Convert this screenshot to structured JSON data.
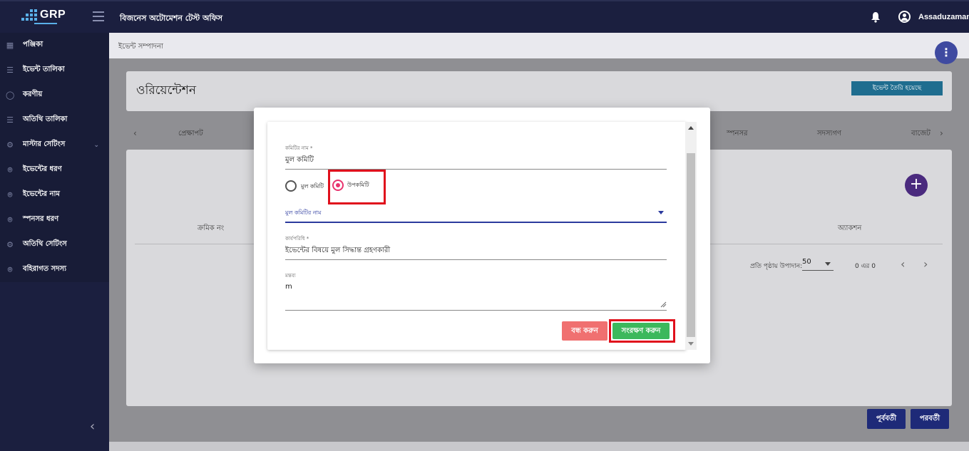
{
  "header": {
    "logo_text": "GRP",
    "app_title": "বিজনেস অটোমেশন টেস্ট অফিস",
    "user_name": "Assaduzaman"
  },
  "sidebar": {
    "items": [
      {
        "label": "পঞ্জিকা",
        "icon": "calendar-icon"
      },
      {
        "label": "ইভেন্ট তালিকা",
        "icon": "list-icon"
      },
      {
        "label": "করণীয়",
        "icon": "check-circle-icon"
      },
      {
        "label": "অতিথি তালিকা",
        "icon": "list-icon"
      },
      {
        "label": "মাস্টার সেটিংস",
        "icon": "gear-icon"
      },
      {
        "label": "ইভেন্টের ধরণ",
        "icon": "location-icon"
      },
      {
        "label": "ইভেন্টের নাম",
        "icon": "location-icon"
      },
      {
        "label": "স্পনসর ধরণ",
        "icon": "location-icon"
      },
      {
        "label": "অতিথি সেটিংস",
        "icon": "gear-icon"
      },
      {
        "label": "বহিরাগত সদস্য",
        "icon": "location-icon"
      }
    ]
  },
  "breadcrumb": "ইভেন্ট সম্পাদনা",
  "page": {
    "title": "ওরিয়েন্টেশন",
    "status_button": "ইভেন্ট তৈরি হয়েছে"
  },
  "tabs": {
    "items": [
      "প্রেক্ষাপট",
      "স্পনসর",
      "সদস্যগণ",
      "বাজেট"
    ]
  },
  "table": {
    "col_serial": "ক্রমিক নং",
    "col_action": "অ্যাকশন",
    "per_page_label": "প্রতি পৃষ্ঠায় উপাদান:",
    "per_page_value": "50",
    "range": "0 এর 0"
  },
  "footer": {
    "prev_label": "পূর্ববর্তী",
    "next_label": "পরবর্তী"
  },
  "dialog": {
    "committee_name_label": "কমিটির নাম *",
    "committee_name_value": "মুল কমিটি",
    "radio_main": "মুল কমিটি",
    "radio_sub": "উপকমিটি",
    "select_label": "মুল কমিটির নাম",
    "scope_label": "কার্যপরিধি *",
    "scope_value": "ইভেন্টের বিষয়ে মুল সিদ্ধান্ত গ্রহণকারী",
    "remarks_label": "মন্তব্য",
    "remarks_value": "m",
    "close_button": "বন্ধ করুন",
    "save_button": "সংরক্ষণ করুন"
  },
  "colors": {
    "nav_bg": "#1b1f3f",
    "primary": "#1e2a78",
    "save": "#3cb85c",
    "close": "#f07070",
    "radio_selected": "#e8336e",
    "highlight": "#e0101c"
  }
}
